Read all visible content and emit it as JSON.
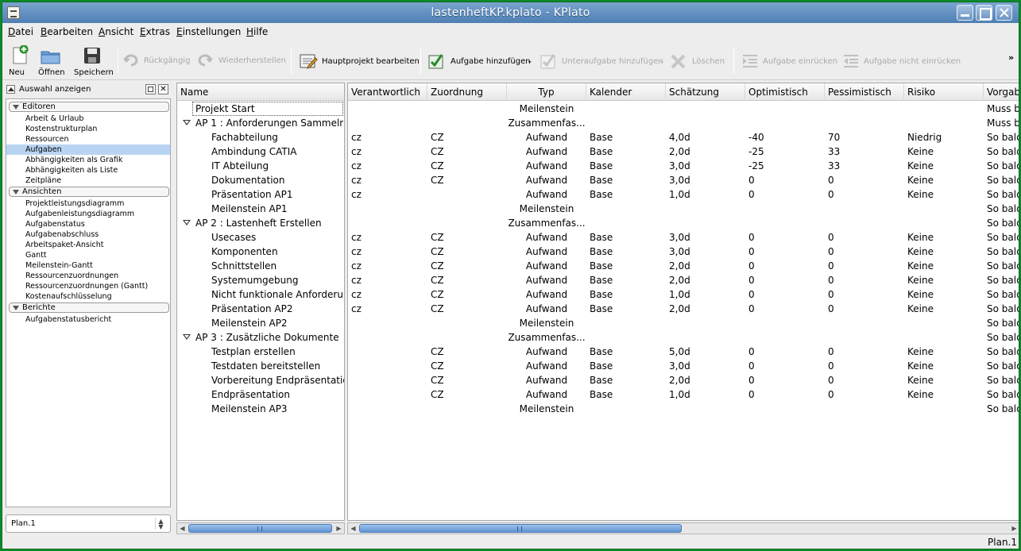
{
  "window": {
    "title": "lastenheftKP.kplato - KPlato"
  },
  "menu": [
    "Datei",
    "Bearbeiten",
    "Ansicht",
    "Extras",
    "Einstellungen",
    "Hilfe"
  ],
  "toolbar": {
    "new": "Neu",
    "open": "Öffnen",
    "save": "Speichern",
    "undo": "Rückgängig",
    "redo": "Wiederherstellen",
    "edit_project": "Hauptprojekt bearbeiten",
    "add_task": "Aufgabe hinzufügen",
    "add_subtask": "Unteraufgabe hinzufügen",
    "delete": "Löschen",
    "indent": "Aufgabe einrücken",
    "unindent": "Aufgabe nicht einrücken",
    "more": "»"
  },
  "sidebar": {
    "header": "Auswahl anzeigen",
    "categories": [
      {
        "label": "Editoren",
        "items": [
          "Arbeit & Urlaub",
          "Kostenstrukturplan",
          "Ressourcen",
          "Aufgaben",
          "Abhängigkeiten als Grafik",
          "Abhängigkeiten als Liste",
          "Zeitpläne"
        ]
      },
      {
        "label": "Ansichten",
        "items": [
          "Projektleistungsdiagramm",
          "Aufgabenleistungsdiagramm",
          "Aufgabenstatus",
          "Aufgabenabschluss",
          "Arbeitspaket-Ansicht",
          "Gantt",
          "Meilenstein-Gantt",
          "Ressourcenzuordnungen",
          "Ressourcenzuordnungen (Gantt)",
          "Kostenaufschlüsselung"
        ]
      },
      {
        "label": "Berichte",
        "items": [
          "Aufgabenstatusbericht"
        ]
      }
    ],
    "selected": "Aufgaben",
    "plan_select": "Plan.1"
  },
  "table": {
    "name_header": "Name",
    "columns": [
      "Verantwortlich",
      "Zuordnung",
      "Typ",
      "Kalender",
      "Schätzung",
      "Optimistisch",
      "Pessimistisch",
      "Risiko",
      "Vorgabe"
    ],
    "rows": [
      {
        "name": "Projekt Start",
        "level": 1,
        "group": false,
        "cells": [
          "",
          "",
          "Meilenstein",
          "",
          "",
          "",
          "",
          "",
          "Muss be"
        ]
      },
      {
        "name": "AP 1 : Anforderungen Sammeln",
        "level": 0,
        "group": true,
        "cells": [
          "",
          "",
          "Zusammenfas...",
          "",
          "",
          "",
          "",
          "",
          "Muss be"
        ]
      },
      {
        "name": "Fachabteilung",
        "level": 2,
        "group": false,
        "cells": [
          "cz",
          "CZ",
          "Aufwand",
          "Base",
          "4,0d",
          "-40",
          "70",
          "Niedrig",
          "So bald"
        ]
      },
      {
        "name": "Ambindung CATIA",
        "level": 2,
        "group": false,
        "cells": [
          "cz",
          "CZ",
          "Aufwand",
          "Base",
          "2,0d",
          "-25",
          "33",
          "Keine",
          "So bald"
        ]
      },
      {
        "name": "IT Abteilung",
        "level": 2,
        "group": false,
        "cells": [
          "cz",
          "CZ",
          "Aufwand",
          "Base",
          "3,0d",
          "-25",
          "33",
          "Keine",
          "So bald"
        ]
      },
      {
        "name": "Dokumentation",
        "level": 2,
        "group": false,
        "cells": [
          "cz",
          "CZ",
          "Aufwand",
          "Base",
          "3,0d",
          "0",
          "0",
          "Keine",
          "So bald"
        ]
      },
      {
        "name": "Präsentation AP1",
        "level": 2,
        "group": false,
        "cells": [
          "cz",
          "",
          "Aufwand",
          "Base",
          "1,0d",
          "0",
          "0",
          "Keine",
          "So bald"
        ]
      },
      {
        "name": "Meilenstein AP1",
        "level": 2,
        "group": false,
        "cells": [
          "",
          "",
          "Meilenstein",
          "",
          "",
          "",
          "",
          "",
          "So bald"
        ]
      },
      {
        "name": "AP 2 : Lastenheft Erstellen",
        "level": 0,
        "group": true,
        "cells": [
          "",
          "",
          "Zusammenfas...",
          "",
          "",
          "",
          "",
          "",
          "So bald"
        ]
      },
      {
        "name": "Usecases",
        "level": 2,
        "group": false,
        "cells": [
          "cz",
          "CZ",
          "Aufwand",
          "Base",
          "3,0d",
          "0",
          "0",
          "Keine",
          "So bald"
        ]
      },
      {
        "name": "Komponenten",
        "level": 2,
        "group": false,
        "cells": [
          "cz",
          "CZ",
          "Aufwand",
          "Base",
          "3,0d",
          "0",
          "0",
          "Keine",
          "So bald"
        ]
      },
      {
        "name": "Schnittstellen",
        "level": 2,
        "group": false,
        "cells": [
          "cz",
          "CZ",
          "Aufwand",
          "Base",
          "2,0d",
          "0",
          "0",
          "Keine",
          "So bald"
        ]
      },
      {
        "name": "Systemumgebung",
        "level": 2,
        "group": false,
        "cells": [
          "cz",
          "CZ",
          "Aufwand",
          "Base",
          "2,0d",
          "0",
          "0",
          "Keine",
          "So bald"
        ]
      },
      {
        "name": "Nicht funktionale Anforderu...",
        "level": 2,
        "group": false,
        "cells": [
          "cz",
          "CZ",
          "Aufwand",
          "Base",
          "1,0d",
          "0",
          "0",
          "Keine",
          "So bald"
        ]
      },
      {
        "name": "Präsentation AP2",
        "level": 2,
        "group": false,
        "cells": [
          "cz",
          "CZ",
          "Aufwand",
          "Base",
          "2,0d",
          "0",
          "0",
          "Keine",
          "So bald"
        ]
      },
      {
        "name": "Meilenstein AP2",
        "level": 2,
        "group": false,
        "cells": [
          "",
          "",
          "Meilenstein",
          "",
          "",
          "",
          "",
          "",
          "So bald"
        ]
      },
      {
        "name": "AP 3 : Zusätzliche Dokumente",
        "level": 0,
        "group": true,
        "cells": [
          "",
          "",
          "Zusammenfas...",
          "",
          "",
          "",
          "",
          "",
          "So bald"
        ]
      },
      {
        "name": "Testplan erstellen",
        "level": 2,
        "group": false,
        "cells": [
          "",
          "CZ",
          "Aufwand",
          "Base",
          "5,0d",
          "0",
          "0",
          "Keine",
          "So bald"
        ]
      },
      {
        "name": "Testdaten bereitstellen",
        "level": 2,
        "group": false,
        "cells": [
          "",
          "CZ",
          "Aufwand",
          "Base",
          "3,0d",
          "0",
          "0",
          "Keine",
          "So bald"
        ]
      },
      {
        "name": "Vorbereitung Endpräsentation",
        "level": 2,
        "group": false,
        "cells": [
          "",
          "CZ",
          "Aufwand",
          "Base",
          "2,0d",
          "0",
          "0",
          "Keine",
          "So bald"
        ]
      },
      {
        "name": "Endpräsentation",
        "level": 2,
        "group": false,
        "cells": [
          "",
          "CZ",
          "Aufwand",
          "Base",
          "1,0d",
          "0",
          "0",
          "Keine",
          "So bald"
        ]
      },
      {
        "name": "Meilenstein AP3",
        "level": 2,
        "group": false,
        "cells": [
          "",
          "",
          "Meilenstein",
          "",
          "",
          "",
          "",
          "",
          "So bald"
        ]
      }
    ]
  },
  "status": {
    "text": "Plan.1"
  },
  "colors": {
    "selection": "#b9d4f2",
    "titlebar": "#5b8abd",
    "frame": "#0a8a2a",
    "scroll_thumb": "#6ea0dc"
  }
}
